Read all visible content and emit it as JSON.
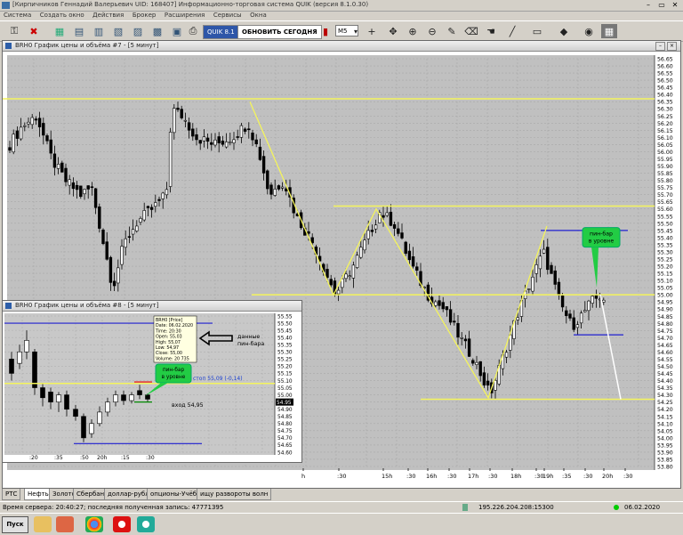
{
  "window": {
    "title": "[Кирпичников Геннадий Валерьевич UID: 168407] Информационно-торговая система QUIK (версия 8.1.0.30)",
    "menu": [
      "Система",
      "Создать окно",
      "Действия",
      "Брокер",
      "Расширения",
      "Сервисы",
      "Окна"
    ]
  },
  "toolbar": {
    "quik_label": "QUIK 8.1",
    "update_label": "ОБНОВИТЬ СЕГОДНЯ",
    "timeframe": "M5"
  },
  "main_chart": {
    "title": "BRH0 График цены и объёма #7 - [5 минут]",
    "y_ticks": [
      "56.65",
      "56.60",
      "56.55",
      "56.50",
      "56.45",
      "56.40",
      "56.35",
      "56.30",
      "56.25",
      "56.20",
      "56.15",
      "56.10",
      "56.05",
      "56.00",
      "55.95",
      "55.90",
      "55.85",
      "55.80",
      "55.75",
      "55.70",
      "55.65",
      "55.60",
      "55.55",
      "55.50",
      "55.45",
      "55.40",
      "55.35",
      "55.30",
      "55.25",
      "55.20",
      "55.15",
      "55.10",
      "55.05",
      "55.00",
      "54.95",
      "54.90",
      "54.85",
      "54.80",
      "54.75",
      "54.70",
      "54.65",
      "54.60",
      "54.55",
      "54.50",
      "54.45",
      "54.40",
      "54.35",
      "54.30",
      "54.25",
      "54.20",
      "54.15",
      "54.10",
      "54.05",
      "54.00",
      "53.95",
      "53.90",
      "53.85",
      "53.80"
    ],
    "x_ticks": [
      "h",
      ":30",
      "15h",
      ":30",
      "16h",
      ":30",
      "17h",
      ":30",
      "18h",
      ":30",
      "19h",
      ":35",
      ":30",
      "20h",
      ":30"
    ],
    "annotation_pinbar": [
      "пин-бар",
      "в уровне"
    ]
  },
  "small_chart": {
    "title": "BRH0 График цены и объёма #8 - [5 минут]",
    "y_ticks": [
      "55.55",
      "55.50",
      "55.45",
      "55.40",
      "55.35",
      "55.30",
      "55.25",
      "55.20",
      "55.15",
      "55.10",
      "55.05",
      "55.00",
      "54.95",
      "54.90",
      "54.85",
      "54.80",
      "54.75",
      "54.70",
      "54.65",
      "54.60"
    ],
    "x_ticks": [
      ":20",
      ":35",
      ":50",
      "20h",
      ":15",
      ":30"
    ],
    "tooltip": [
      "BRH0 [Price]",
      "Date: 06.02.2020",
      "Time: 20:30",
      "Open: 55,03",
      "High: 55,07",
      "Low: 54,97",
      "Close: 55,00",
      "Volume: 20 735"
    ],
    "pinbar_label": [
      "пин-бар",
      "в уровне"
    ],
    "stop_label": "стоп 55,09 (-0,14)",
    "entry_label": "вход  54,95",
    "price_label": "54.95",
    "data_label": [
      "данные",
      "пин-бара"
    ]
  },
  "tabs": [
    "РТС",
    "Нефть",
    "Золото",
    "Сбербанк",
    "доллар-рубль",
    "опционы-Учёба",
    "ищу развороты волн"
  ],
  "active_tab": "Нефть",
  "status": {
    "server_time": "Время сервера: 20:40:27; последняя полученная запись: 47771395",
    "server_address": "195.226.204.208:15300",
    "date": "06.02.2020"
  },
  "taskbar": {
    "start_label": "Пуск"
  },
  "colors": {
    "level": "#f4f45c",
    "blue_level": "#1f1fd0",
    "pinbar_box": "#22cc44"
  }
}
